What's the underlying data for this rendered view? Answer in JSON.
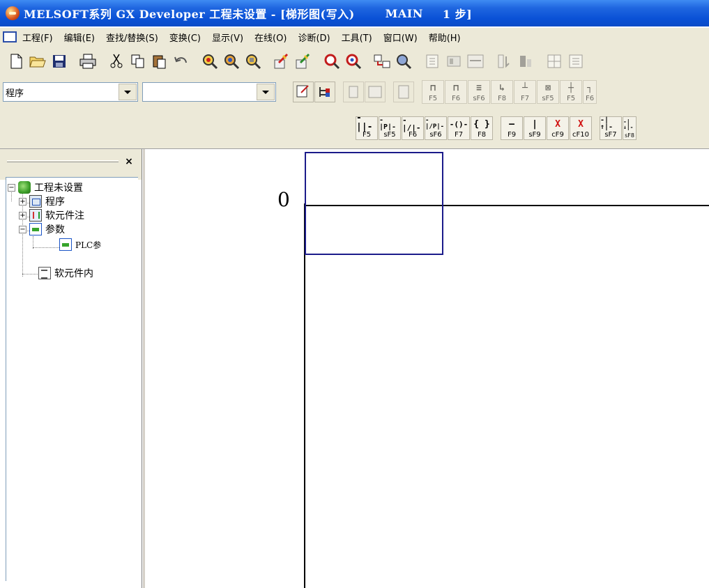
{
  "window": {
    "title_parts": [
      "MELSOFT系列 GX Developer",
      "工程未设置 -",
      "[梯形图(写入)",
      "MAIN",
      "1 步]"
    ]
  },
  "menu": [
    "工程(F)",
    "编辑(E)",
    "查找/替换(S)",
    "变换(C)",
    "显示(V)",
    "在线(O)",
    "诊断(D)",
    "工具(T)",
    "窗口(W)",
    "帮助(H)"
  ],
  "toolbar2": {
    "data_type_combo": "程序",
    "data_name_combo": ""
  },
  "ladder_keys": [
    {
      "sym": "-||-",
      "label": "F5"
    },
    {
      "sym": "-|P|-",
      "label": "sF5"
    },
    {
      "sym": "-|/|-",
      "label": "F6"
    },
    {
      "sym": "-|/P|-",
      "label": "sF6"
    },
    {
      "sym": "-()-",
      "label": "F7"
    },
    {
      "sym": "{ }",
      "label": "F8"
    },
    {
      "sym": "—",
      "label": "F9"
    },
    {
      "sym": "|",
      "label": "sF9"
    },
    {
      "sym": "X",
      "label": "cF9"
    },
    {
      "sym": "X",
      "label": "cF10"
    },
    {
      "sym": "-|↑|-",
      "label": "sF7"
    },
    {
      "sym": "-|↓|-",
      "label": "sF8"
    }
  ],
  "toolbar2_fkeys": [
    "F5",
    "F6",
    "sF6",
    "F8",
    "F7",
    "sF5",
    "F5",
    "F6"
  ],
  "project_tree": {
    "root": "工程未设置",
    "program": "程序",
    "device_comment": "软元件注",
    "parameter": "参数",
    "plc_param": "PLC参",
    "device_memory": "软元件内"
  },
  "ladder": {
    "step_number": "0"
  }
}
